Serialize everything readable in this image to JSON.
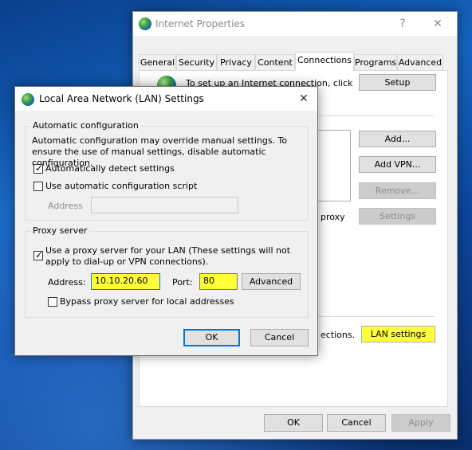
{
  "internet_properties": {
    "title": "Internet Properties",
    "help": "?",
    "close": "✕",
    "tabs": [
      "General",
      "Security",
      "Privacy",
      "Content",
      "Connections",
      "Programs",
      "Advanced"
    ],
    "active_tab": "Connections",
    "setup_text": "To set up an Internet connection, click",
    "setup_button": "Setup",
    "add_button": "Add...",
    "add_vpn_button": "Add VPN...",
    "remove_button": "Remove...",
    "settings_button": "Settings",
    "proxy_fragment": "proxy",
    "lan_fragment_1": "ections.",
    "lan_fragment_2": "",
    "lan_settings_button": "LAN settings",
    "ok_button": "OK",
    "cancel_button": "Cancel",
    "apply_button": "Apply"
  },
  "lan_dialog": {
    "title": "Local Area Network (LAN) Settings",
    "close": "✕",
    "auto_config": {
      "title": "Automatic configuration",
      "description": "Automatic configuration may override manual settings.  To ensure the use of manual settings, disable automatic configuration.",
      "auto_detect_label": "Automatically detect settings",
      "auto_detect_checked": true,
      "script_label": "Use automatic configuration script",
      "script_checked": false,
      "address_label": "Address",
      "address_value": ""
    },
    "proxy": {
      "title": "Proxy server",
      "use_proxy_label": "Use a proxy server for your LAN (These settings will not apply to dial-up or VPN connections).",
      "use_proxy_checked": true,
      "address_label": "Address:",
      "address_value": "10.10.20.60",
      "port_label": "Port:",
      "port_value": "80",
      "advanced_button": "Advanced",
      "bypass_label": "Bypass proxy server for local addresses",
      "bypass_checked": false
    },
    "ok_button": "OK",
    "cancel_button": "Cancel"
  },
  "colors": {
    "highlight": "#ffff3a",
    "focus_border": "#0078d7",
    "desktop": "#1565c0"
  }
}
